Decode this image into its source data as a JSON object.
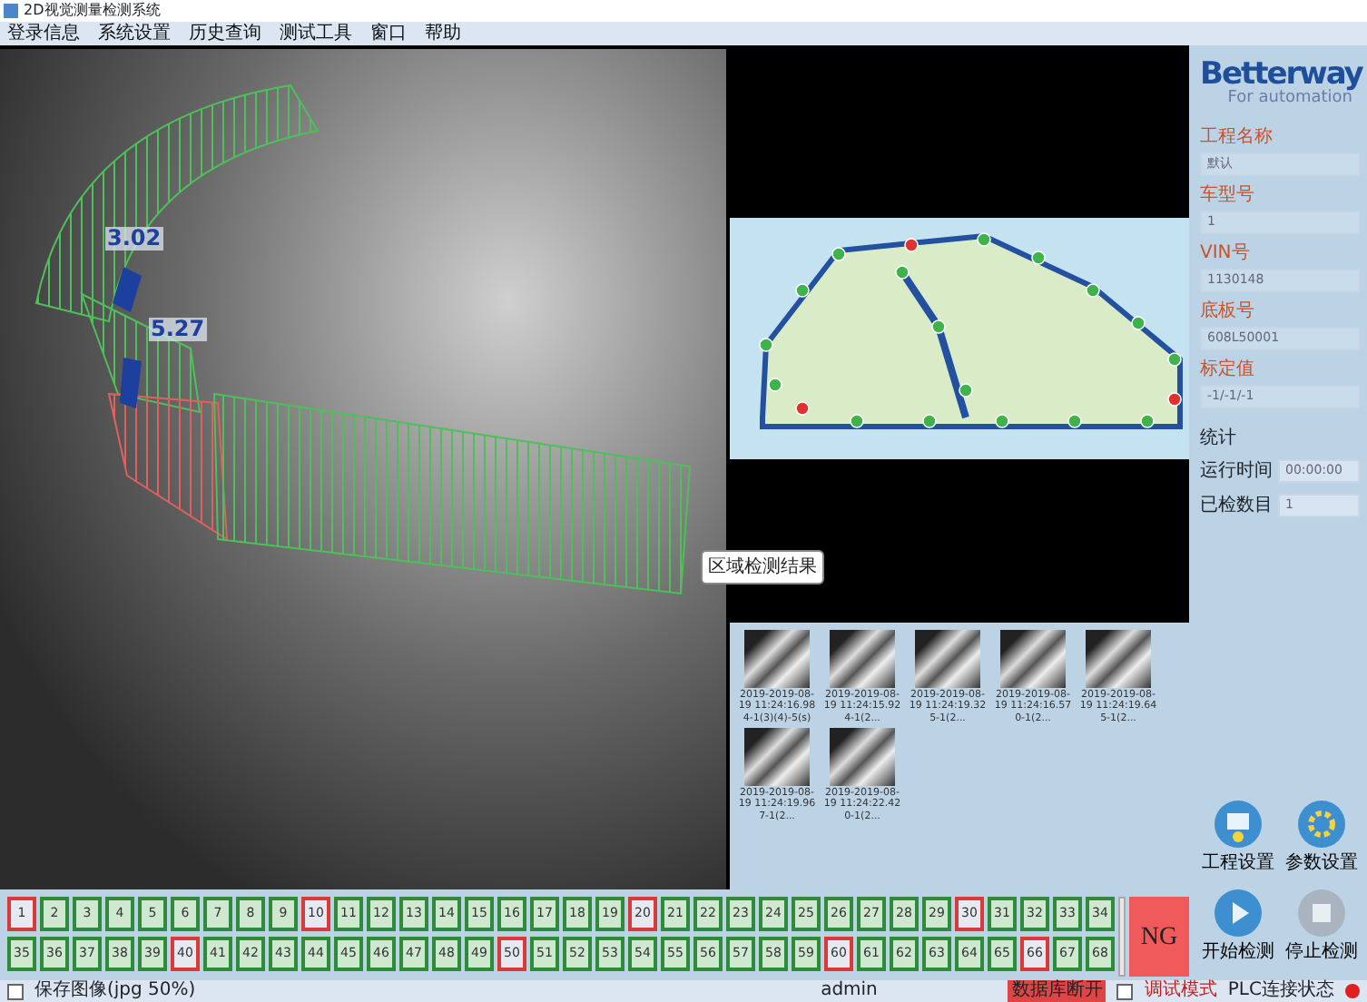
{
  "window": {
    "title": "2D视觉测量检测系统"
  },
  "menu": [
    {
      "label": "登录信息"
    },
    {
      "label": "系统设置"
    },
    {
      "label": "历史查询"
    },
    {
      "label": "测试工具"
    },
    {
      "label": "窗口"
    },
    {
      "label": "帮助"
    }
  ],
  "camera_view": {
    "measurements": [
      "3.02",
      "5.27"
    ],
    "tooltip": "区域检测结果"
  },
  "thumbnails": [
    {
      "caption": "2019-2019-08-19 11:24:16.984-1(3)(4)-5(s)"
    },
    {
      "caption": "2019-2019-08-19 11:24:15.924-1(2..."
    },
    {
      "caption": "2019-2019-08-19 11:24:19.325-1(2..."
    },
    {
      "caption": "2019-2019-08-19 11:24:16.570-1(2..."
    },
    {
      "caption": "2019-2019-08-19 11:24:19.645-1(2..."
    },
    {
      "caption": "2019-2019-08-19 11:24:19.967-1(2..."
    },
    {
      "caption": "2019-2019-08-19 11:24:22.420-1(2..."
    }
  ],
  "project_panel": {
    "logo": {
      "name": "Betterway",
      "tagline": "For automation"
    },
    "fields": [
      {
        "label": "工程名称",
        "value": "默认"
      },
      {
        "label": "车型号",
        "value": "1"
      },
      {
        "label": "VIN号",
        "value": "1130148"
      },
      {
        "label": "底板号",
        "value": "608L50001"
      },
      {
        "label": "标定值",
        "value": "-1/-1/-1"
      }
    ],
    "stats": {
      "title": "统计",
      "rows": [
        {
          "label": "运行时间",
          "value": "00:00:00"
        },
        {
          "label": "已检数目",
          "value": "1"
        }
      ]
    },
    "buttons": [
      {
        "label": "工程设置",
        "kind": "project"
      },
      {
        "label": "参数设置",
        "kind": "gear"
      },
      {
        "label": "开始检测",
        "kind": "start"
      },
      {
        "label": "停止检测",
        "kind": "stop"
      }
    ]
  },
  "points": [
    {
      "label": "1",
      "ng": true
    },
    {
      "label": "2",
      "ng": false
    },
    {
      "label": "3",
      "ng": false
    },
    {
      "label": "4",
      "ng": false
    },
    {
      "label": "5",
      "ng": false
    },
    {
      "label": "6",
      "ng": false
    },
    {
      "label": "7",
      "ng": false
    },
    {
      "label": "8",
      "ng": false
    },
    {
      "label": "9",
      "ng": false
    },
    {
      "label": "10",
      "ng": true
    },
    {
      "label": "11",
      "ng": false
    },
    {
      "label": "12",
      "ng": false
    },
    {
      "label": "13",
      "ng": false
    },
    {
      "label": "14",
      "ng": false
    },
    {
      "label": "15",
      "ng": false
    },
    {
      "label": "16",
      "ng": false
    },
    {
      "label": "17",
      "ng": false
    },
    {
      "label": "18",
      "ng": false
    },
    {
      "label": "19",
      "ng": false
    },
    {
      "label": "20",
      "ng": true
    },
    {
      "label": "21",
      "ng": false
    },
    {
      "label": "22",
      "ng": false
    },
    {
      "label": "23",
      "ng": false
    },
    {
      "label": "24",
      "ng": false
    },
    {
      "label": "25",
      "ng": false
    },
    {
      "label": "26",
      "ng": false
    },
    {
      "label": "27",
      "ng": false
    },
    {
      "label": "28",
      "ng": false
    },
    {
      "label": "29",
      "ng": false
    },
    {
      "label": "30",
      "ng": true
    },
    {
      "label": "31",
      "ng": false
    },
    {
      "label": "32",
      "ng": false
    },
    {
      "label": "33",
      "ng": false
    },
    {
      "label": "34",
      "ng": false
    },
    {
      "label": "35",
      "ng": false
    },
    {
      "label": "36",
      "ng": false
    },
    {
      "label": "37",
      "ng": false
    },
    {
      "label": "38",
      "ng": false
    },
    {
      "label": "39",
      "ng": false
    },
    {
      "label": "40",
      "ng": true
    },
    {
      "label": "41",
      "ng": false
    },
    {
      "label": "42",
      "ng": false
    },
    {
      "label": "43",
      "ng": false
    },
    {
      "label": "44",
      "ng": false
    },
    {
      "label": "45",
      "ng": false
    },
    {
      "label": "46",
      "ng": false
    },
    {
      "label": "47",
      "ng": false
    },
    {
      "label": "48",
      "ng": false
    },
    {
      "label": "49",
      "ng": false
    },
    {
      "label": "50",
      "ng": true
    },
    {
      "label": "51",
      "ng": false
    },
    {
      "label": "52",
      "ng": false
    },
    {
      "label": "53",
      "ng": false
    },
    {
      "label": "54",
      "ng": false
    },
    {
      "label": "55",
      "ng": false
    },
    {
      "label": "56",
      "ng": false
    },
    {
      "label": "57",
      "ng": false
    },
    {
      "label": "58",
      "ng": false
    },
    {
      "label": "59",
      "ng": false
    },
    {
      "label": "60",
      "ng": true
    },
    {
      "label": "61",
      "ng": false
    },
    {
      "label": "62",
      "ng": false
    },
    {
      "label": "63",
      "ng": false
    },
    {
      "label": "64",
      "ng": false
    },
    {
      "label": "65",
      "ng": false
    },
    {
      "label": "66",
      "ng": true
    },
    {
      "label": "67",
      "ng": false
    },
    {
      "label": "68",
      "ng": false
    }
  ],
  "result": {
    "text": "NG",
    "ng": true
  },
  "status_bar": {
    "save_option": {
      "label": "保存图像(jpg 50%)",
      "checked": false
    },
    "user": "admin",
    "db_status": "数据库断开",
    "debug_mode": {
      "label": "调试模式",
      "checked": false
    },
    "plc_label": "PLC连接状态",
    "plc_connected": false
  }
}
